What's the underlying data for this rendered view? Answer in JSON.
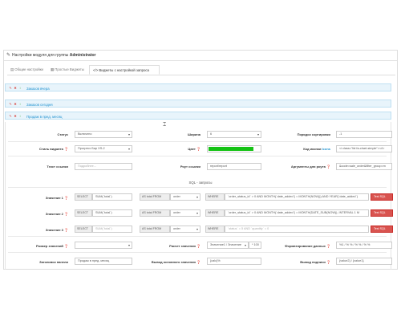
{
  "header": {
    "prefix": "Настройки модуля для группы",
    "group": "Administrator"
  },
  "tabs": [
    {
      "label": "Общие настройки"
    },
    {
      "label": "Простые Виджеты"
    },
    {
      "label": "Виджеты с настройкой запроса"
    }
  ],
  "tab_icons": {
    "t0": "▤",
    "t1": "▦",
    "t2": "</>"
  },
  "widgets": [
    {
      "controls": [
        "✎",
        "✖",
        "↕"
      ],
      "title": "Заказов вчера",
      "colors": {
        "a": "#d9534f",
        "b": "#5cb85c"
      }
    },
    {
      "controls": [
        "✎",
        "✖",
        "↕"
      ],
      "title": "Заказов сегодня"
    },
    {
      "controls": [
        "✎",
        "✖",
        "↕"
      ],
      "title": "Продаж в пред. месяц"
    }
  ],
  "form": {
    "status_label": "Статус",
    "status_value": "Включено",
    "width_label": "Ширина",
    "width_value": "6",
    "sort_label": "Порядок сортировки",
    "sort_value": "-1",
    "style_label": "Стиль виджета",
    "style_value": "Прогресс Бар XS-2",
    "color_label": "Цвет",
    "icon_label": "Код иконки",
    "icon_link": "Icons",
    "icon_value": "<i class=\"fal fa-chart-simple\"></i>",
    "link_text_label": "Текст ссылки",
    "link_text_placeholder": "Подробнее...",
    "route_label": "Роут ссылки",
    "route_value": "report/report",
    "route_args_label": "Аргументы для роута",
    "route_args_value": "&code=sale_order&filter_group=m",
    "sql_title": "SQL - запросы",
    "value1_label": "Значение 1",
    "value2_label": "Значение 2",
    "value3_label": "Значение 3",
    "select_kw": "SELECT",
    "from_kw": "AS total FROM",
    "where_kw": "WHERE",
    "v1_select": "SUM(`total`)",
    "v1_from": "order",
    "v1_where": "`order_status_id` > 0 AND MONTH(`date_added`) = MONTH(NOW()) AND YEAR(`date_added`)",
    "v2_select": "SUM(`total`)",
    "v2_from": "order",
    "v2_where": "`order_status_id` > 0 AND MONTH(`date_added`) = MONTH(DATE_SUB(NOW(), INTERVAL 1 M",
    "v3_select_ph": "SUM(`total`)",
    "v3_from": "order",
    "v3_where_ph": "`status` = 5 AND `quantity` = 0",
    "test_sql": "Test SQL",
    "dim_label": "Размер значений",
    "dim_value": "",
    "calc_label": "Расчет значения",
    "calc_value": "Значение1 / Значение",
    "calc_mult": "* 100",
    "format_label": "Форматирование данных",
    "format_value": "%1 / % % / % % / % %",
    "title_label": "Заголовок панели",
    "title_value": "Продаж в пред. месяц",
    "out_label": "Вывод основного значения",
    "out_value": "{calc}%",
    "sign_label": "Вывод подписи",
    "sign_value": "{value2} / {value1}"
  }
}
